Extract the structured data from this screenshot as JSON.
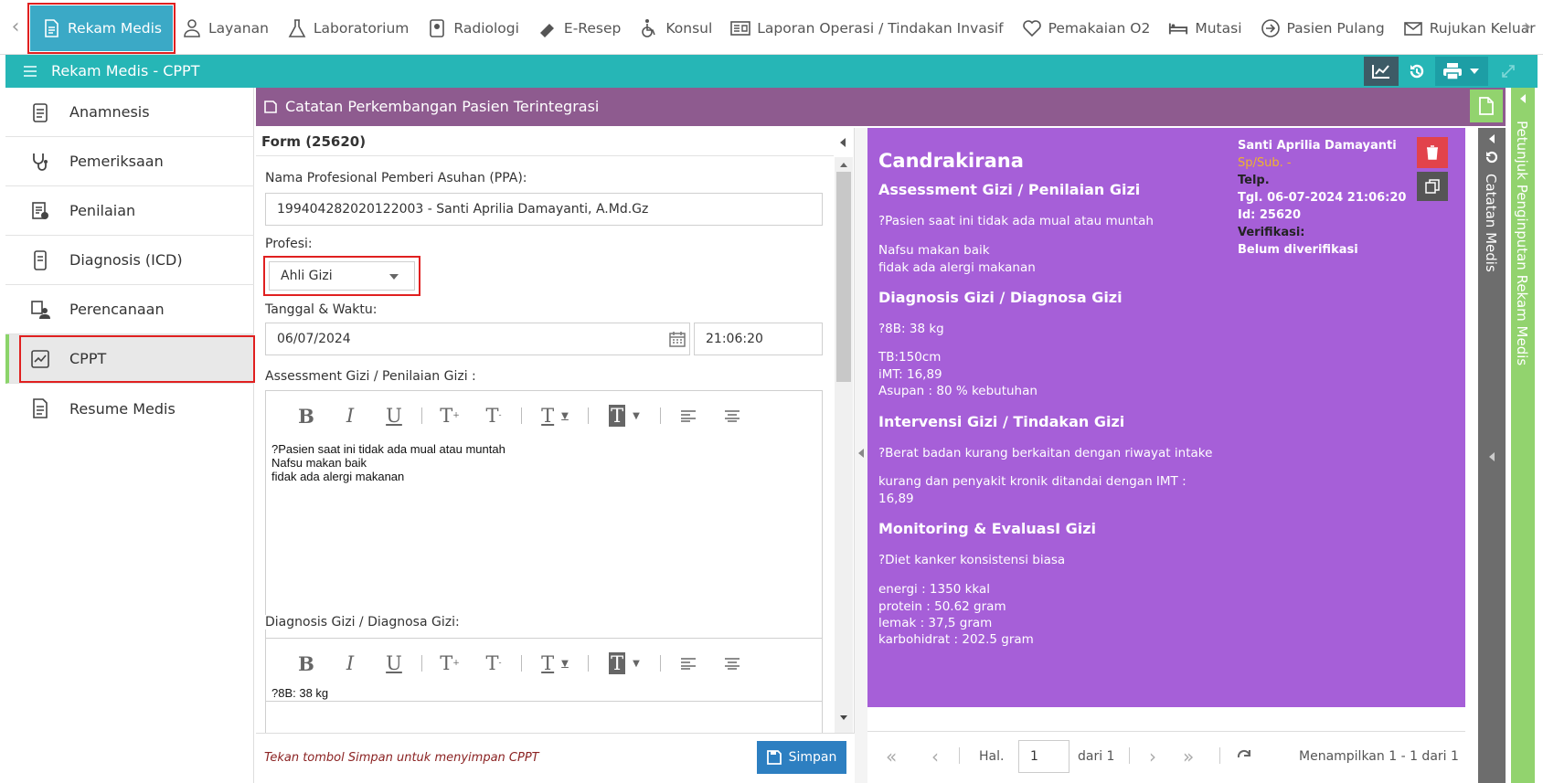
{
  "topnav": {
    "items": [
      {
        "label": "Rekam Medis",
        "icon": "document-icon"
      },
      {
        "label": "Layanan",
        "icon": "doctor-icon"
      },
      {
        "label": "Laboratorium",
        "icon": "flask-icon"
      },
      {
        "label": "Radiologi",
        "icon": "xray-icon"
      },
      {
        "label": "E-Resep",
        "icon": "pill-icon"
      },
      {
        "label": "Konsul",
        "icon": "wheelchair-icon"
      },
      {
        "label": "Laporan Operasi / Tindakan Invasif",
        "icon": "report-icon"
      },
      {
        "label": "Pemakaian O2",
        "icon": "heart-icon"
      },
      {
        "label": "Mutasi",
        "icon": "bed-icon"
      },
      {
        "label": "Pasien Pulang",
        "icon": "arrow-circle-icon"
      },
      {
        "label": "Rujukan Keluar",
        "icon": "envelope-icon"
      }
    ]
  },
  "tealbar": {
    "title": "Rekam Medis - CPPT"
  },
  "sidebar": {
    "items": [
      {
        "label": "Anamnesis"
      },
      {
        "label": "Pemeriksaan"
      },
      {
        "label": "Penilaian"
      },
      {
        "label": "Diagnosis (ICD)"
      },
      {
        "label": "Perencanaan"
      },
      {
        "label": "CPPT"
      },
      {
        "label": "Resume Medis"
      }
    ]
  },
  "header": {
    "title": "Catatan Perkembangan Pasien Terintegrasi"
  },
  "form": {
    "title": "Form (25620)",
    "ppa_label": "Nama Profesional Pemberi Asuhan (PPA):",
    "ppa_value": "199404282020122003 - Santi Aprilia Damayanti, A.Md.Gz",
    "profesi_label": "Profesi:",
    "profesi_value": "Ahli Gizi",
    "datetime_label": "Tanggal & Waktu:",
    "date_value": "06/07/2024",
    "time_value": "21:06:20",
    "assessment_label": "Assessment Gizi / Penilaian Gizi :",
    "assessment_text": "?Pasien saat ini tidak ada mual atau muntah\nNafsu makan baik\nfidak ada alergi makanan",
    "diagnosis_label": "Diagnosis Gizi / Diagnosa Gizi:",
    "diagnosis_text": "?8B: 38 kg\nTB:150cm",
    "footer_hint": "Tekan tombol Simpan untuk menyimpan CPPT",
    "save_label": "Simpan"
  },
  "preview": {
    "patient": "Candrakirana",
    "author": "Santi Aprilia Damayanti",
    "spsub": "Sp/Sub. -",
    "telp": "Telp.",
    "tgl": "Tgl. 06-07-2024 21:06:20",
    "id": "Id: 25620",
    "verif_label": "Verifikasi:",
    "verif_value": "Belum diverifikasi",
    "s1_title": "Assessment Gizi / Penilaian Gizi",
    "s1_l1": "?Pasien saat ini tidak ada mual atau muntah",
    "s1_l2": "Nafsu makan baik",
    "s1_l3": "fidak ada alergi makanan",
    "s2_title": "Diagnosis Gizi / Diagnosa Gizi",
    "s2_l1": "?8B: 38 kg",
    "s2_l2": "TB:150cm",
    "s2_l3": "iMT: 16,89",
    "s2_l4": "Asupan : 80 % kebutuhan",
    "s3_title": "Intervensi Gizi / Tindakan Gizi",
    "s3_l1": "?Berat badan kurang berkaitan dengan riwayat intake",
    "s3_l2": "kurang dan penyakit kronik ditandai dengan IMT :",
    "s3_l3": "16,89",
    "s4_title": "Monitoring & EvaluasI Gizi",
    "s4_l1": "?Diet kanker konsistensi biasa",
    "s4_l2": "energi : 1350 kkal",
    "s4_l3": "protein : 50.62 gram",
    "s4_l4": "lemak : 37,5 gram",
    "s4_l5": "karbohidrat : 202.5 gram"
  },
  "pager": {
    "hal_label": "Hal.",
    "page": "1",
    "of_label": "dari 1",
    "summary": "Menampilkan 1 - 1 dari 1"
  },
  "rightpanels": {
    "catatan": "Catatan Medis",
    "petunjuk": "Petunjuk Penginputan Rekam Medis"
  },
  "colors": {
    "teal": "#26b6b6",
    "purple_header": "#8e5b8f",
    "preview_bg": "#a65fd8",
    "active_nav": "#3ba9c6",
    "highlight": "#e02020"
  }
}
